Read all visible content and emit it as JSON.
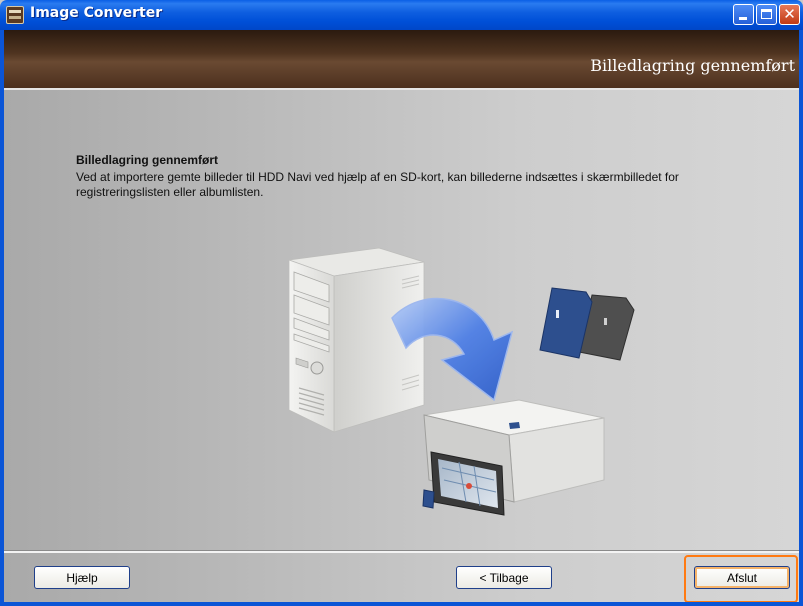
{
  "window": {
    "title": "Image Converter"
  },
  "header": {
    "title": "Billedlagring gennemført"
  },
  "content": {
    "title": "Billedlagring gennemført",
    "description": "Ved at importere gemte billeder til HDD Navi ved hjælp af en SD-kort, kan billederne indsættes i skærmbilledet for registreringslisten eller albumlisten."
  },
  "footer": {
    "help_label": "Hjælp",
    "back_label": "< Tilbage",
    "finish_label": "Afslut"
  },
  "icons": {
    "app": "image-converter-icon",
    "minimize": "minimize-icon",
    "maximize": "maximize-icon",
    "close": "close-icon"
  },
  "colors": {
    "titlebar": "#0050d8",
    "header": "#4f3420",
    "highlight": "#ff7a12",
    "close_button": "#c13a13"
  }
}
